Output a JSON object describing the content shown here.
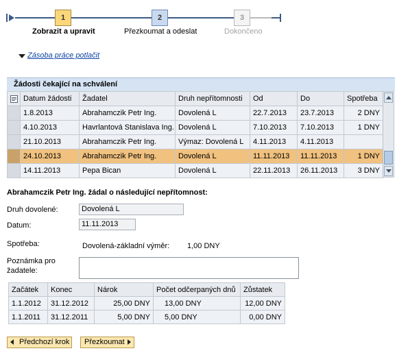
{
  "roadmap": {
    "steps": [
      {
        "number": "1",
        "label": "Zobrazit a upravit",
        "state": "active"
      },
      {
        "number": "2",
        "label": "Přezkoumat a odeslat",
        "state": "normal"
      },
      {
        "number": "3",
        "label": "Dokončeno",
        "state": "disabled"
      }
    ]
  },
  "collapse_link": "Zásoba práce potlačit",
  "requests": {
    "title": "Žádosti čekající na schválení",
    "columns": [
      "Datum žádosti",
      "Žadatel",
      "Druh nepřítomnosti",
      "Od",
      "Do",
      "Spotřeba"
    ],
    "rows": [
      {
        "date": "1.8.2013",
        "applicant": "Abrahamczik Petr Ing.",
        "type": "Dovolená L",
        "from": "22.7.2013",
        "to": "23.7.2013",
        "usage": "2 DNY",
        "selected": false
      },
      {
        "date": "4.10.2013",
        "applicant": "Havrlantová Stanislava Ing.",
        "type": "Dovolená L",
        "from": "7.10.2013",
        "to": "7.10.2013",
        "usage": "1 DNY",
        "selected": false
      },
      {
        "date": "21.10.2013",
        "applicant": "Abrahamczik Petr Ing.",
        "type": "Výmaz: Dovolená L",
        "from": "4.11.2013",
        "to": "4.11.2013",
        "usage": "",
        "selected": false
      },
      {
        "date": "24.10.2013",
        "applicant": "Abrahamczik Petr Ing.",
        "type": "Dovolená L",
        "from": "11.11.2013",
        "to": "11.11.2013",
        "usage": "1 DNY",
        "selected": true
      },
      {
        "date": "14.11.2013",
        "applicant": "Pepa Bican",
        "type": "Dovolená L",
        "from": "22.11.2013",
        "to": "26.11.2013",
        "usage": "3 DNY",
        "selected": false
      }
    ]
  },
  "detail": {
    "title": "Abrahamczik Petr Ing. žádal o následující nepřítomnost:",
    "leave_type_label": "Druh dovolené:",
    "leave_type_value": "Dovolená L",
    "date_label": "Datum:",
    "date_value": "11.11.2013",
    "usage_label": "Spotřeba:",
    "usage_type": "Dovolená-základní výměr:",
    "usage_value": "1,00 DNY",
    "note_label_line1": "Poznámka pro",
    "note_label_line2": "žadatele:",
    "note_value": ""
  },
  "balances": {
    "columns": [
      "Začátek",
      "Konec",
      "Nárok",
      "Počet odčerpaných dnů",
      "Zůstatek"
    ],
    "rows": [
      {
        "start": "1.1.2012",
        "end": "31.12.2012",
        "entitlement": "25,00 DNY",
        "used": "13,00 DNY",
        "remaining": "12,00 DNY"
      },
      {
        "start": "1.1.2011",
        "end": "31.12.2011",
        "entitlement": "5,00 DNY",
        "used": "5,00 DNY",
        "remaining": "0,00 DNY"
      }
    ]
  },
  "buttons": {
    "previous": "Předchozí krok",
    "next": "Přezkoumat"
  },
  "colors": {
    "selected_row": "#f0c17f",
    "active_step": "#fcd77a",
    "link": "#0d43a3",
    "button": "#fbe7b0"
  }
}
